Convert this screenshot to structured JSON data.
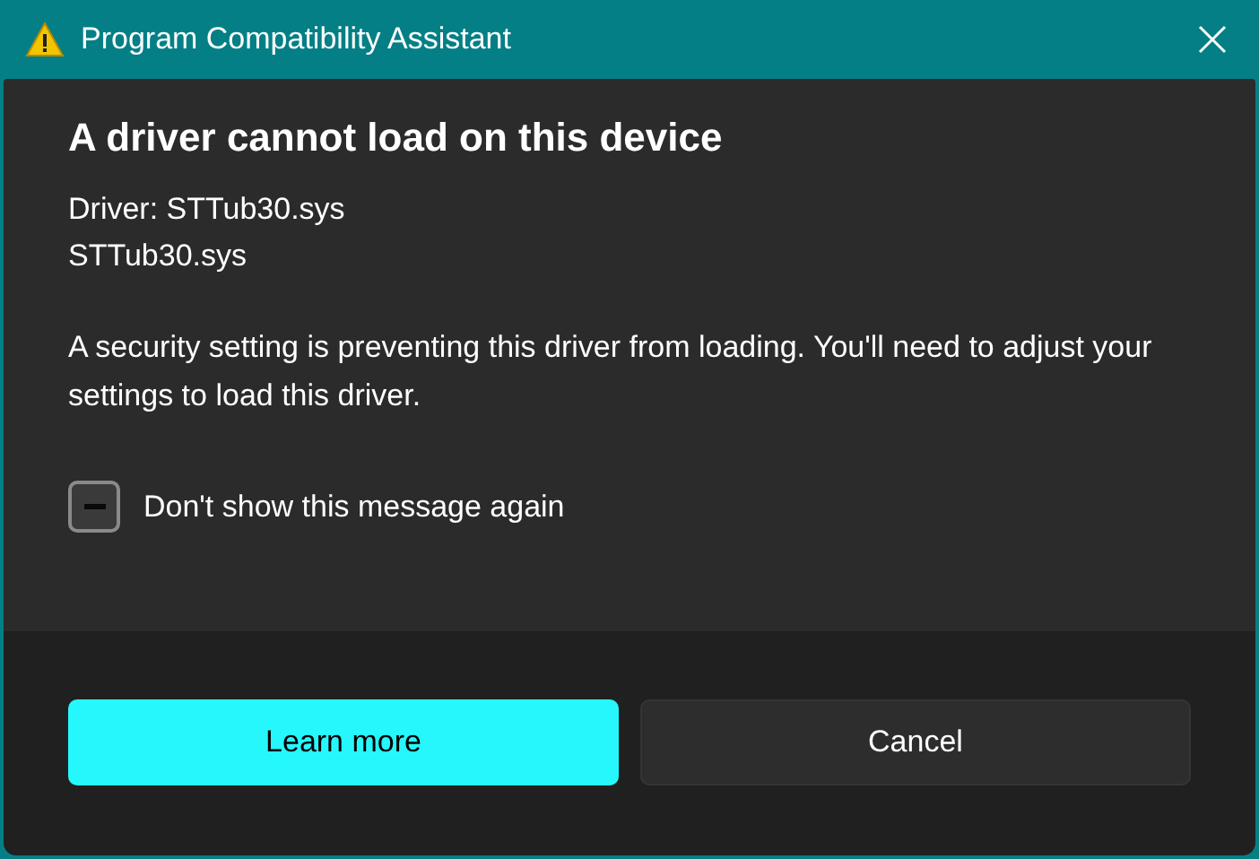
{
  "window": {
    "title": "Program Compatibility Assistant"
  },
  "heading": "A driver cannot load on this device",
  "details": [
    "Driver: STTub30.sys",
    "STTub30.sys"
  ],
  "message": "A security setting is preventing this driver from loading. You'll need to adjust your settings to load this driver.",
  "checkbox": {
    "label": "Don't show this message again",
    "checked": false,
    "indeterminate": true
  },
  "buttons": [
    {
      "label": "Learn more",
      "kind": "primary"
    },
    {
      "label": "Cancel",
      "kind": "secondary"
    }
  ]
}
